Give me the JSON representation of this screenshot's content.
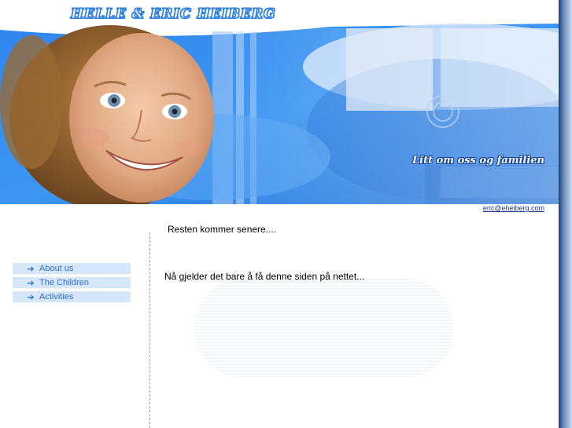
{
  "header": {
    "site_title": "HELLE & ERIC HEIBERG",
    "tagline": "Litt om oss og familien"
  },
  "contact": {
    "email": "eric@eheiberg.com"
  },
  "sidebar": {
    "items": [
      {
        "label": "About us",
        "icon": "arrow-right-icon"
      },
      {
        "label": "The Children",
        "icon": "arrow-right-icon"
      },
      {
        "label": "Activities",
        "icon": "arrow-right-icon"
      }
    ]
  },
  "main": {
    "line1": "Resten kommer senere....",
    "line2": "Nå gjelder det bare å få denne siden på nettet..."
  },
  "colors": {
    "banner_blue": "#3a8ff0",
    "nav_bg": "#d6e6fb",
    "nav_text": "#2f6fd0",
    "link": "#1a3c8c"
  }
}
